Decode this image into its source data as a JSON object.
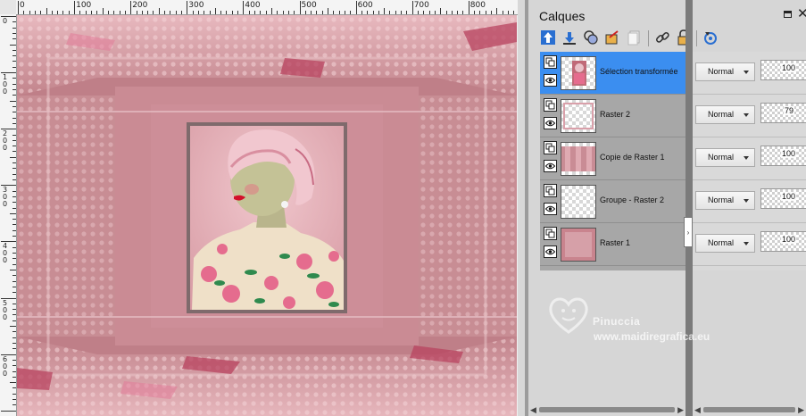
{
  "ruler": {
    "top_labels": [
      "0",
      "100",
      "200",
      "300",
      "400",
      "500",
      "600",
      "700",
      "800"
    ],
    "left_labels": [
      "0",
      "1 0 0",
      "2 0 0",
      "3 0 0",
      "4 0 0",
      "5 0 0",
      "6 0 0"
    ]
  },
  "canvas": {
    "description_icons": [
      "woman-portrait-image"
    ]
  },
  "panel": {
    "title": "Calques",
    "toolbar_icons": [
      "new-raster-layer-icon",
      "new-vector-layer-icon",
      "new-mask-layer-icon",
      "adjustment-layer-icon",
      "duplicate-layer-icon",
      "link-layer-icon",
      "lock-layer-icon",
      "rotate-properties-icon"
    ]
  },
  "layers": [
    {
      "name": "Sélection transformée",
      "blend": "Normal",
      "opacity": "100",
      "selected": true,
      "thumb": "portrait"
    },
    {
      "name": "Raster 2",
      "blend": "Normal",
      "opacity": "79",
      "selected": false,
      "thumb": "frame"
    },
    {
      "name": "Copie de Raster 1",
      "blend": "Normal",
      "opacity": "100",
      "selected": false,
      "thumb": "stripes"
    },
    {
      "name": "Groupe - Raster 2",
      "blend": "Normal",
      "opacity": "100",
      "selected": false,
      "thumb": "blank"
    },
    {
      "name": "Raster 1",
      "blend": "Normal",
      "opacity": "100",
      "selected": false,
      "thumb": "pink"
    }
  ],
  "watermark": {
    "name": "Pinuccia",
    "url": "www.maidiregrafica.eu"
  },
  "colors": {
    "selected_row": "#3b8ef0",
    "canvas_pink": "#b8767f",
    "toolbar_blue": "#2a6fd1"
  }
}
